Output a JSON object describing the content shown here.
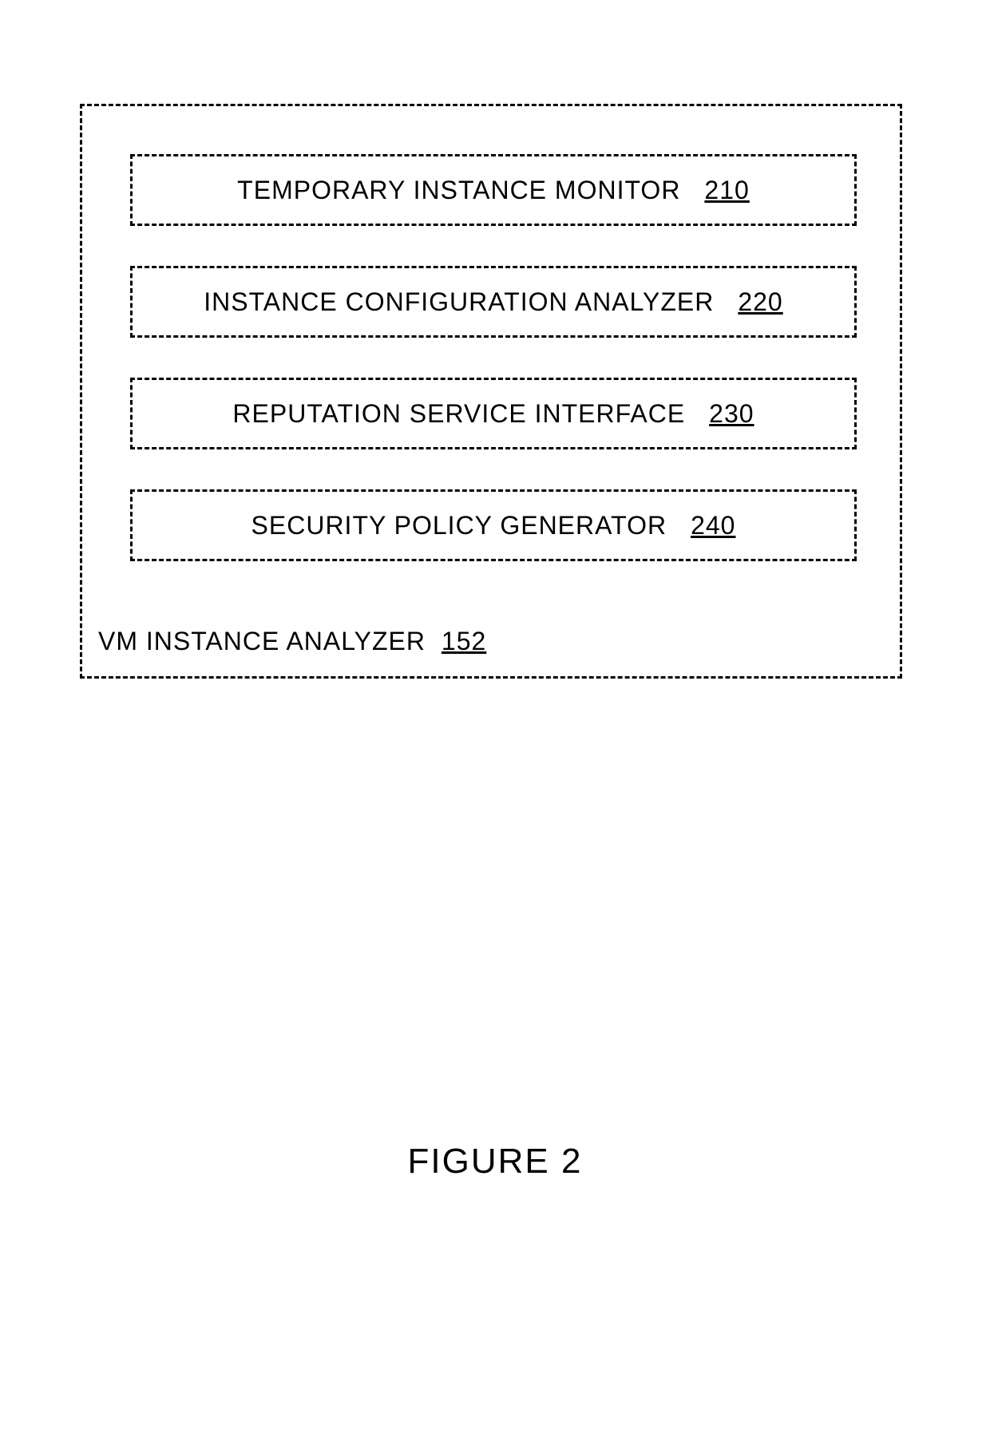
{
  "container": {
    "label": "VM INSTANCE ANALYZER",
    "ref": "152"
  },
  "boxes": [
    {
      "label": "TEMPORARY INSTANCE MONITOR",
      "ref": "210"
    },
    {
      "label": "INSTANCE CONFIGURATION ANALYZER",
      "ref": "220"
    },
    {
      "label": "REPUTATION SERVICE INTERFACE",
      "ref": "230"
    },
    {
      "label": "SECURITY POLICY GENERATOR",
      "ref": "240"
    }
  ],
  "figure_caption": "FIGURE 2"
}
